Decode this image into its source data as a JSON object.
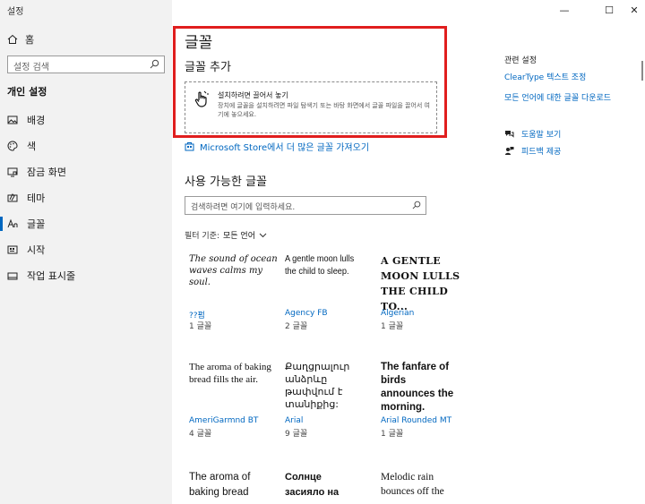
{
  "window": {
    "title": "설정",
    "minimize": "—",
    "maximize": "☐",
    "close": "✕"
  },
  "sidebar": {
    "home_label": "홈",
    "search_placeholder": "설정 검색",
    "section_title": "개인 설정",
    "items": [
      {
        "label": "배경",
        "icon": "image-icon"
      },
      {
        "label": "색",
        "icon": "palette-icon"
      },
      {
        "label": "잠금 화면",
        "icon": "lock-screen-icon"
      },
      {
        "label": "테마",
        "icon": "theme-icon"
      },
      {
        "label": "글꼴",
        "icon": "font-icon",
        "active": true
      },
      {
        "label": "시작",
        "icon": "start-icon"
      },
      {
        "label": "작업 표시줄",
        "icon": "taskbar-icon"
      }
    ]
  },
  "main": {
    "title": "글꼴",
    "add_fonts_title": "글꼴 추가",
    "drop_title": "설치하려면 끌어서 놓기",
    "drop_desc": "장치에 글꼴을 설치하려면 파일 탐색기 또는 바탕 화면에서 글꼴 파일을 끌어서 여기에 놓으세요.",
    "store_link": "Microsoft Store에서 더 많은 글꼴 가져오기",
    "available_title": "사용 가능한 글꼴",
    "search_placeholder": "검색하려면 여기에 입력하세요.",
    "filter_label": "필터 기준:",
    "filter_value": "모든 언어",
    "fonts": [
      {
        "preview": "The sound of ocean waves calms my soul.",
        "name": "??펌",
        "count": "1 글꼴"
      },
      {
        "preview": "A gentle moon lulls the child to sleep.",
        "name": "Agency FB",
        "count": "2 글꼴"
      },
      {
        "preview": "A GENTLE MOON LULLS THE CHILD TO...",
        "name": "Algerian",
        "count": "1 글꼴"
      },
      {
        "preview": "The aroma of baking bread fills the air.",
        "name": "AmeriGarmnd BT",
        "count": "4 글꼴"
      },
      {
        "preview": "Քաղցրալուր անձրևը թափվում է տանիքից:",
        "name": "Arial",
        "count": "9 글꼴"
      },
      {
        "preview": "The fanfare of birds announces the morning.",
        "name": "Arial Rounded MT",
        "count": "1 글꼴"
      },
      {
        "preview": "The aroma of baking bread",
        "name": "",
        "count": ""
      },
      {
        "preview": "Солнце засияло на",
        "name": "",
        "count": ""
      },
      {
        "preview": "Melodic rain bounces off the",
        "name": "",
        "count": ""
      }
    ]
  },
  "related": {
    "title": "관련 설정",
    "links": [
      "ClearType 텍스트 조정",
      "모든 언어에 대한 글꼴 다운로드"
    ],
    "help": [
      {
        "label": "도움말 보기",
        "icon": "help-icon"
      },
      {
        "label": "피드백 제공",
        "icon": "feedback-icon"
      }
    ]
  }
}
